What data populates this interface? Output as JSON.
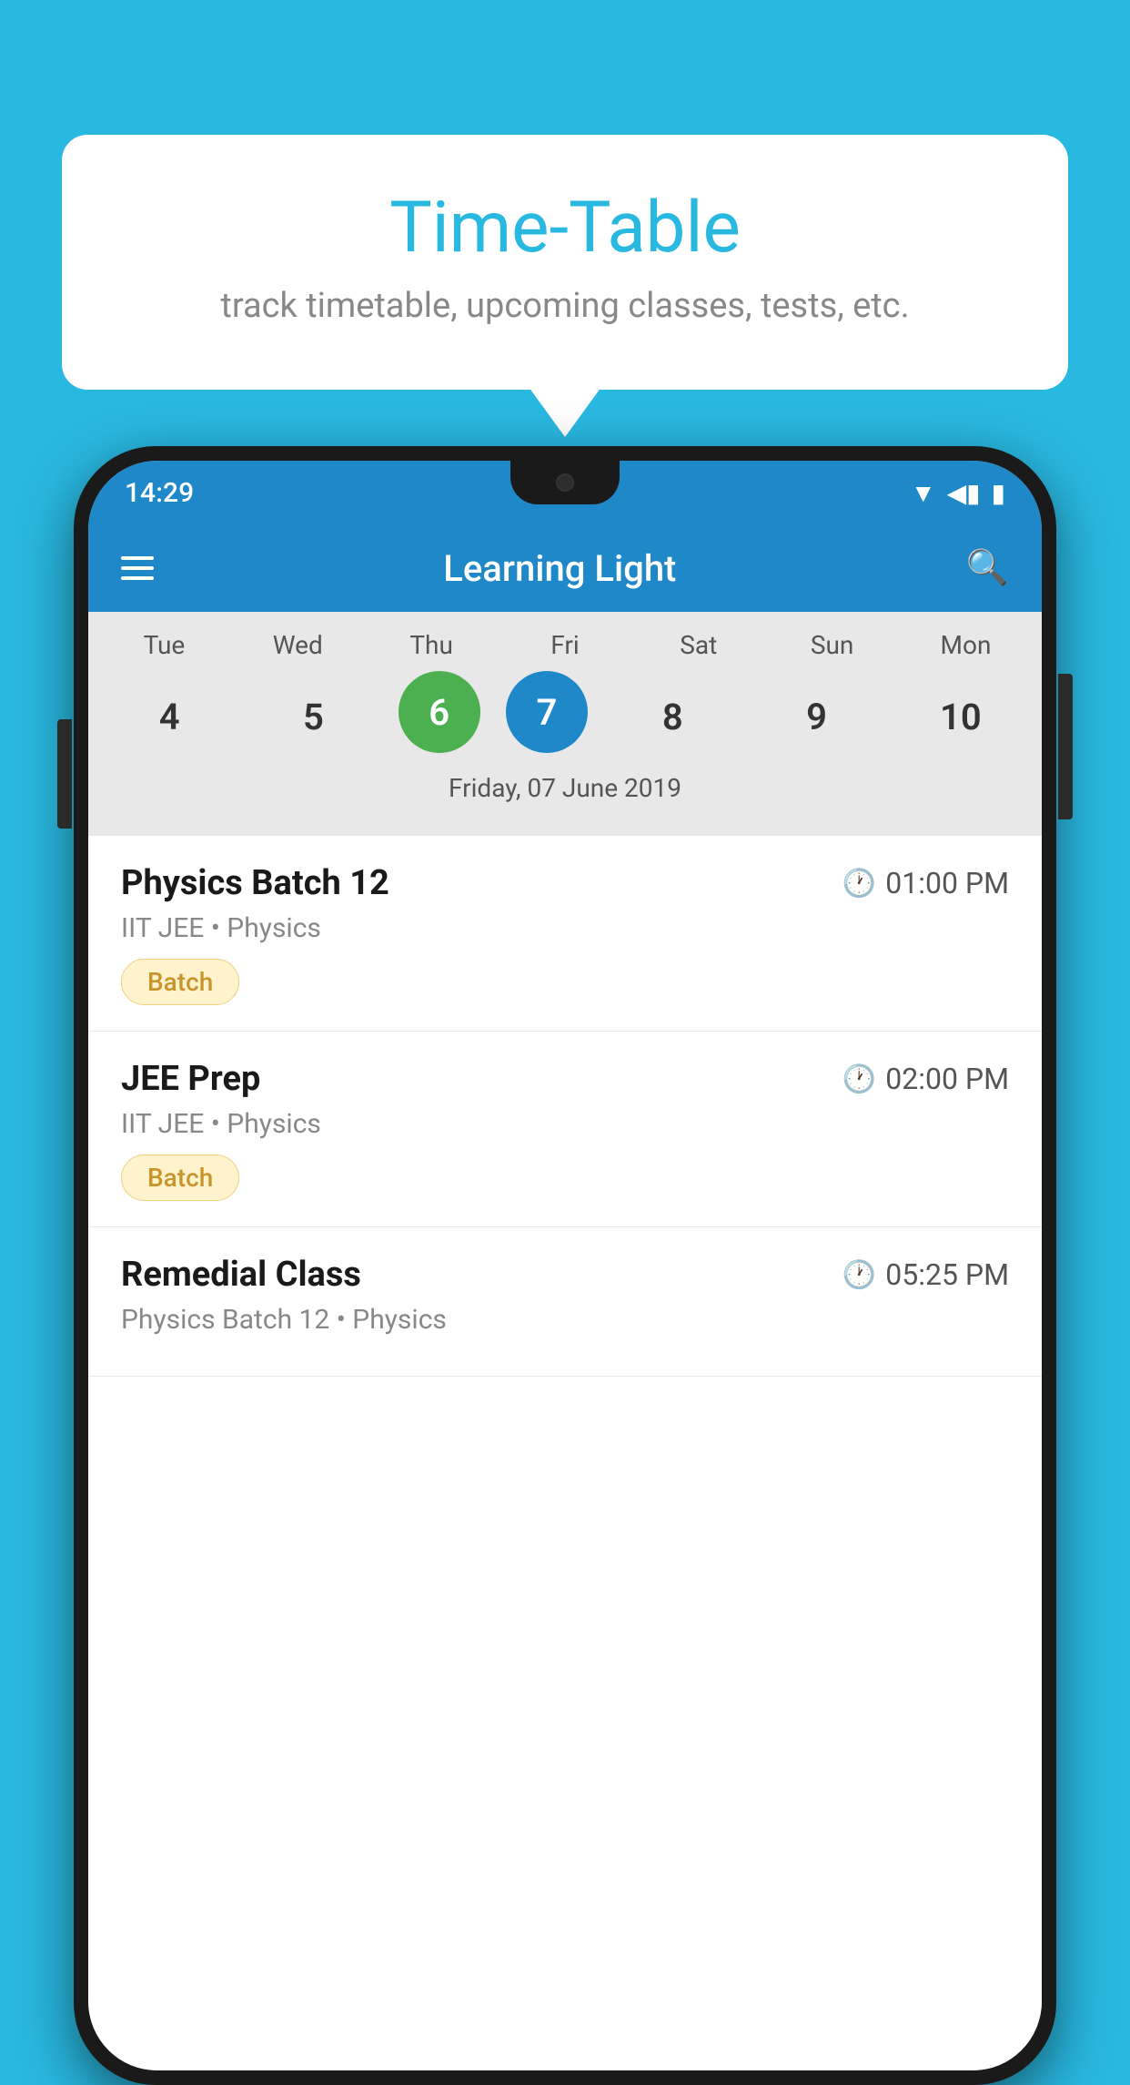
{
  "background": {
    "color": "#29b8e0"
  },
  "tooltip": {
    "title": "Time-Table",
    "subtitle": "track timetable, upcoming classes, tests, etc."
  },
  "phone": {
    "status_bar": {
      "time": "14:29"
    },
    "header": {
      "title": "Learning Light",
      "menu_icon": "hamburger",
      "search_icon": "search"
    },
    "calendar": {
      "days": [
        "Tue",
        "Wed",
        "Thu",
        "Fri",
        "Sat",
        "Sun",
        "Mon"
      ],
      "dates": [
        "4",
        "5",
        "6",
        "7",
        "8",
        "9",
        "10"
      ],
      "today_index": 2,
      "selected_index": 3,
      "selected_label": "Friday, 07 June 2019"
    },
    "classes": [
      {
        "name": "Physics Batch 12",
        "time": "01:00 PM",
        "subject": "IIT JEE • Physics",
        "tag": "Batch"
      },
      {
        "name": "JEE Prep",
        "time": "02:00 PM",
        "subject": "IIT JEE • Physics",
        "tag": "Batch"
      },
      {
        "name": "Remedial Class",
        "time": "05:25 PM",
        "subject": "Physics Batch 12 • Physics",
        "tag": ""
      }
    ]
  }
}
